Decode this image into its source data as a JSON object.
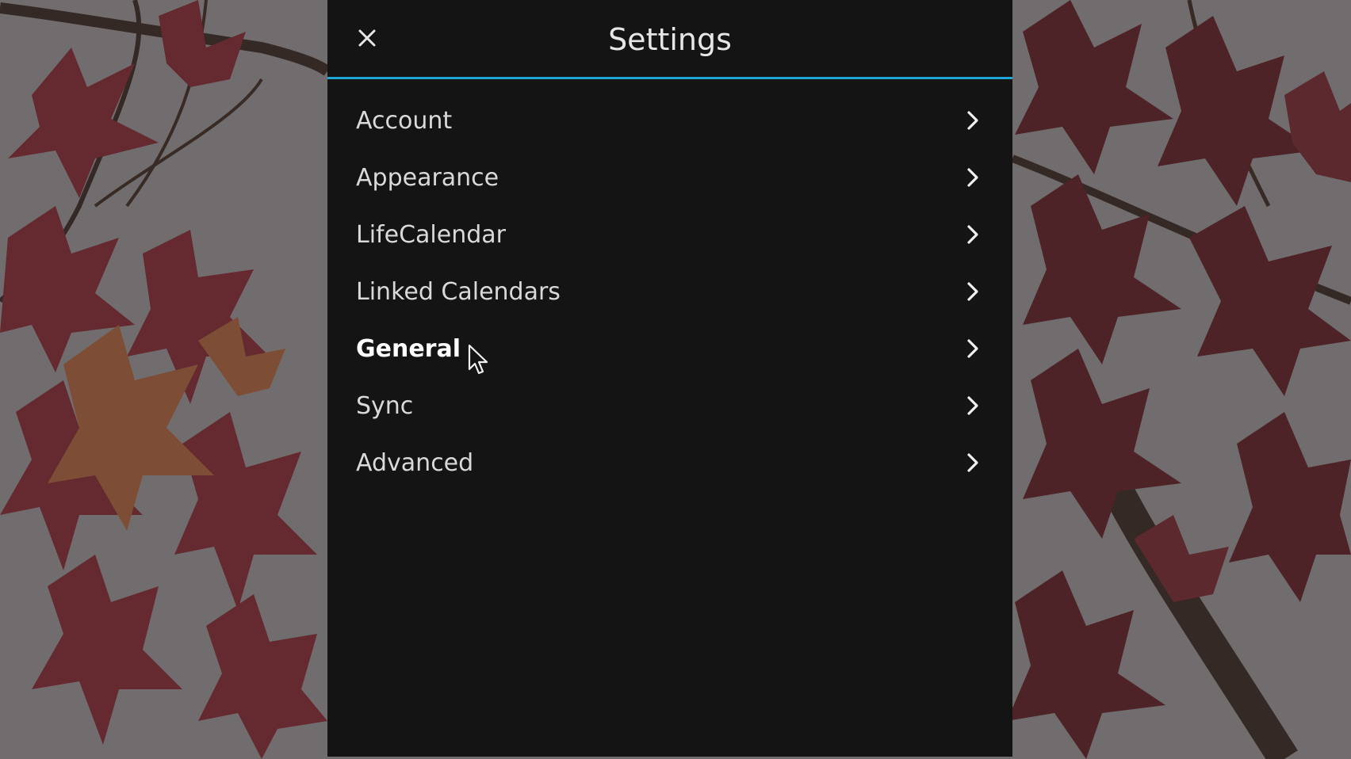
{
  "window": {
    "title": "Settings"
  },
  "icons": {
    "close": "close-icon",
    "chevron": "chevron-right-icon",
    "cursor": "mouse-pointer-icon"
  },
  "colors": {
    "panel_bg": "#141414",
    "accent_line": "#1ea7d6",
    "text": "#d9d9d9",
    "text_hover": "#ffffff"
  },
  "menu": {
    "items": [
      {
        "label": "Account"
      },
      {
        "label": "Appearance"
      },
      {
        "label": "LifeCalendar"
      },
      {
        "label": "Linked Calendars"
      },
      {
        "label": "General"
      },
      {
        "label": "Sync"
      },
      {
        "label": "Advanced"
      }
    ],
    "hovered_index": 4
  }
}
